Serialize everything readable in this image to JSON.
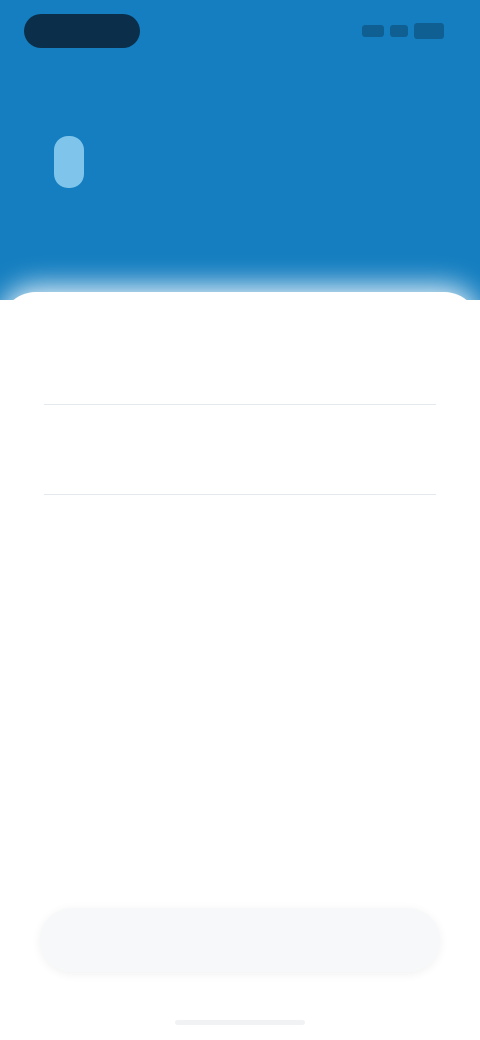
{
  "status_bar": {
    "time": "",
    "icons": [
      "signal-icon",
      "wifi-icon",
      "battery-icon"
    ]
  },
  "header": {
    "back_icon": "back-arrow-icon",
    "device_icon": "earbud-icon",
    "title_line_1": "",
    "title_line_2": "",
    "background_color": "#147ec0"
  },
  "fields": [
    {
      "label": "",
      "value": ""
    },
    {
      "label": "",
      "value": ""
    }
  ],
  "footer": {
    "button_label": ""
  },
  "colors": {
    "accent": "#147ec0",
    "device_icon": "#7fc4ea",
    "sheet": "#ffffff"
  }
}
